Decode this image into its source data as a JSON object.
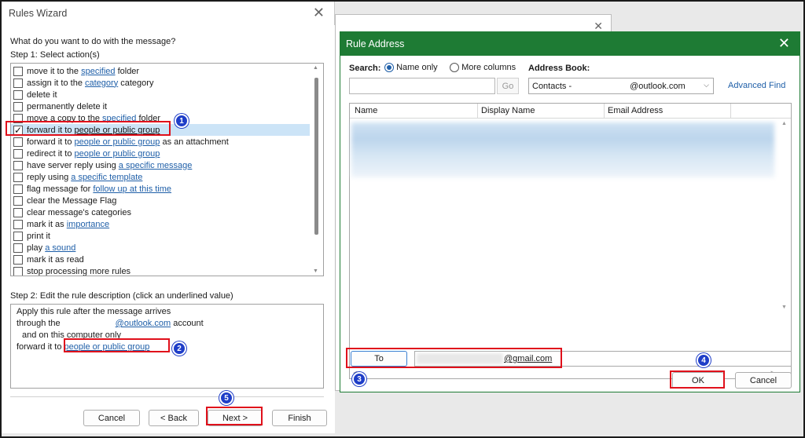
{
  "rules_wizard": {
    "title": "Rules Wizard",
    "question": "What do you want to do with the message?",
    "step1_label": "Step 1: Select action(s)",
    "actions": [
      {
        "pre": "move it to the ",
        "link": "specified",
        "post": " folder",
        "checked": false
      },
      {
        "pre": "assign it to the ",
        "link": "category",
        "post": " category",
        "checked": false
      },
      {
        "pre": "delete it",
        "link": "",
        "post": "",
        "checked": false
      },
      {
        "pre": "permanently delete it",
        "link": "",
        "post": "",
        "checked": false
      },
      {
        "pre": "move a copy to the ",
        "link": "specified",
        "post": " folder",
        "checked": false
      },
      {
        "pre": "forward it to ",
        "link": "people or public group",
        "post": "",
        "checked": true
      },
      {
        "pre": "forward it to ",
        "link": "people or public group",
        "post": " as an attachment",
        "checked": false
      },
      {
        "pre": "redirect it to ",
        "link": "people or public group",
        "post": "",
        "checked": false
      },
      {
        "pre": "have server reply using ",
        "link": "a specific message",
        "post": "",
        "checked": false
      },
      {
        "pre": "reply using ",
        "link": "a specific template",
        "post": "",
        "checked": false
      },
      {
        "pre": "flag message for ",
        "link": "follow up at this time",
        "post": "",
        "checked": false
      },
      {
        "pre": "clear the Message Flag",
        "link": "",
        "post": "",
        "checked": false
      },
      {
        "pre": "clear message's categories",
        "link": "",
        "post": "",
        "checked": false
      },
      {
        "pre": "mark it as ",
        "link": "importance",
        "post": "",
        "checked": false
      },
      {
        "pre": "print it",
        "link": "",
        "post": "",
        "checked": false
      },
      {
        "pre": "play ",
        "link": "a sound",
        "post": "",
        "checked": false
      },
      {
        "pre": "mark it as read",
        "link": "",
        "post": "",
        "checked": false
      },
      {
        "pre": "stop processing more rules",
        "link": "",
        "post": "",
        "checked": false
      }
    ],
    "step2_label": "Step 2: Edit the rule description (click an underlined value)",
    "description": {
      "line1": "Apply this rule after the message arrives",
      "line2_pre": "through the",
      "line2_link": "@outlook.com",
      "line2_post": " account",
      "line3": "and on this computer only",
      "line4_pre": "forward it to ",
      "line4_link": "people or public group"
    },
    "buttons": {
      "cancel": "Cancel",
      "back": "< Back",
      "next": "Next >",
      "finish": "Finish"
    }
  },
  "rule_address": {
    "title": "Rule Address",
    "search_label": "Search:",
    "radio_name_only": "Name only",
    "radio_more_columns": "More columns",
    "address_book_label": "Address Book:",
    "go_button": "Go",
    "address_book_value": "Contacts -",
    "address_book_email": "@outlook.com",
    "advanced_find": "Advanced Find",
    "columns": [
      "Name",
      "Display Name",
      "Email Address"
    ],
    "to_button": "To",
    "to_value": "@gmail.com",
    "ok_button": "OK",
    "cancel_button": "Cancel"
  },
  "badges": [
    "1",
    "2",
    "3",
    "4",
    "5"
  ],
  "colors": {
    "titlebar_green": "#1e7b34",
    "annotation_red": "#e0101b",
    "badge_blue": "#1f3ec8",
    "link_blue": "#1f5fa8",
    "selection": "#cce4f7"
  }
}
